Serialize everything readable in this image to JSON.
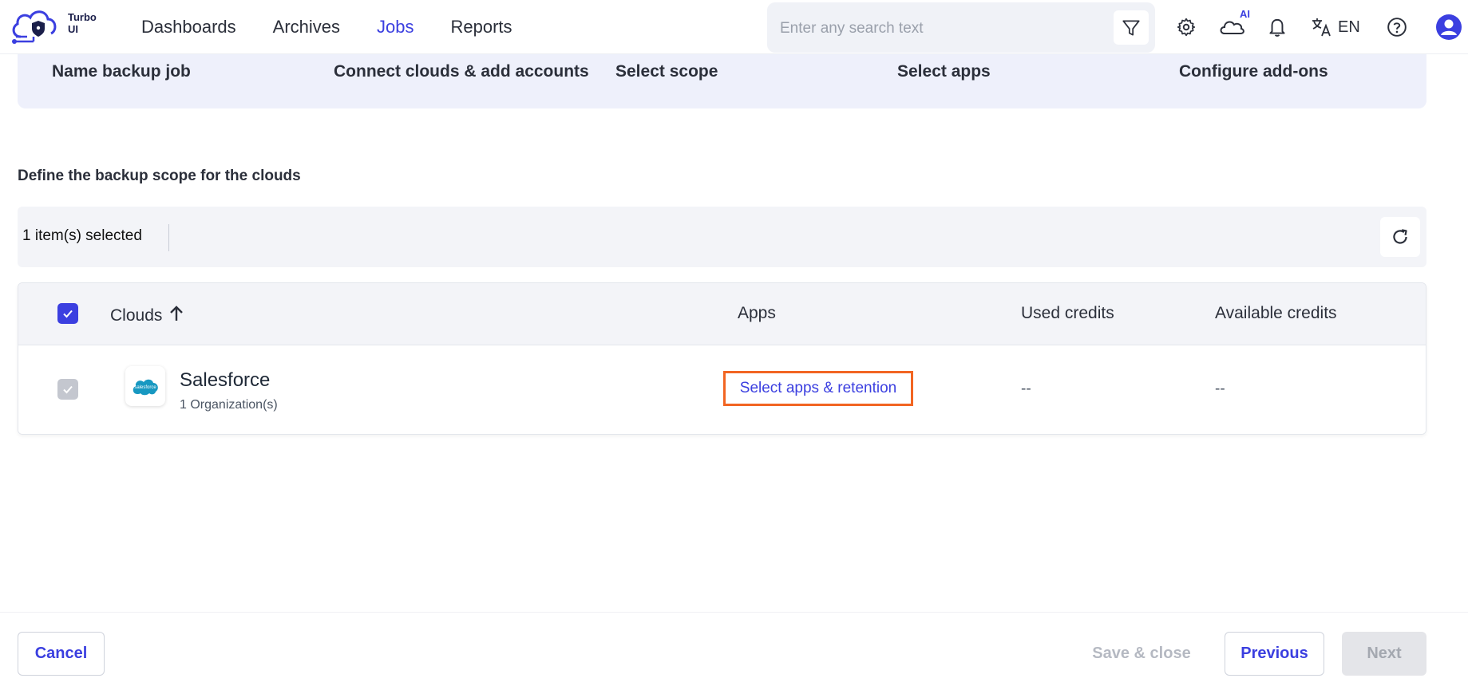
{
  "brand": {
    "name": "Turbo UI"
  },
  "nav": [
    {
      "label": "Dashboards"
    },
    {
      "label": "Archives"
    },
    {
      "label": "Jobs"
    },
    {
      "label": "Reports"
    }
  ],
  "search": {
    "placeholder": "Enter any search text"
  },
  "header_icons": {
    "ai_badge": "AI",
    "language": "EN"
  },
  "steps": [
    {
      "label": "Name backup job"
    },
    {
      "label": "Connect clouds & add accounts"
    },
    {
      "label": "Select scope"
    },
    {
      "label": "Select apps"
    },
    {
      "label": "Configure add-ons"
    }
  ],
  "section": {
    "title": "Define the backup scope for the clouds"
  },
  "selection": {
    "count_label": "1 item(s) selected"
  },
  "table": {
    "columns": {
      "clouds": "Clouds",
      "apps": "Apps",
      "used_credits": "Used credits",
      "available_credits": "Available credits"
    },
    "rows": [
      {
        "name": "Salesforce",
        "subtitle": "1 Organization(s)",
        "logo_text": "salesforce",
        "apps_link": "Select apps & retention",
        "used_credits": "--",
        "available_credits": "--"
      }
    ]
  },
  "footer": {
    "cancel": "Cancel",
    "save_close": "Save & close",
    "previous": "Previous",
    "next": "Next"
  },
  "colors": {
    "accent": "#3b3fe0",
    "highlight": "#f26522"
  }
}
